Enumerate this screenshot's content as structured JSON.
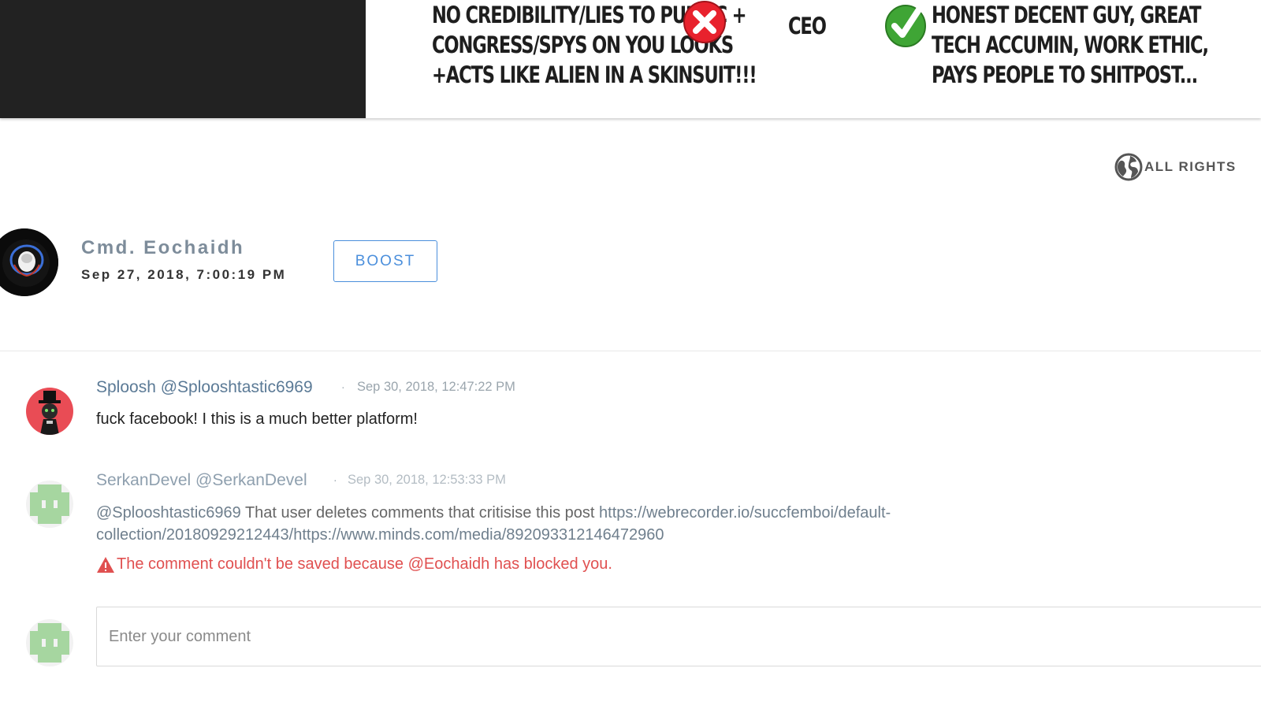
{
  "banner": {
    "left_lines": [
      "NO CREDIBILITY/LIES TO PUBLIC +",
      "CONGRESS/SPYS ON YOU LOOKS",
      "+ACTS LIKE ALIEN IN A SKINSUIT!!!"
    ],
    "center_label": "CEO",
    "right_lines": [
      "HONEST DECENT GUY, GREAT",
      "TECH ACCUMIN, WORK ETHIC,",
      "PAYS PEOPLE TO SHITPOST..."
    ],
    "x_icon": "red-x-icon",
    "check_icon": "green-check-icon"
  },
  "license": {
    "icon": "globe-icon",
    "label": "ALL RIGHTS"
  },
  "owner": {
    "name": "Cmd. Eochaidh",
    "date": "Sep 27, 2018, 7:00:19 PM",
    "boost_label": "BOOST"
  },
  "comments": [
    {
      "author": "Sploosh @Splooshtastic6969",
      "separator": "·",
      "time": "Sep 30, 2018, 12:47:22 PM",
      "body": "fuck facebook! I this is a much better platform!"
    },
    {
      "author": "SerkanDevel @SerkanDevel",
      "separator": "·",
      "time": "Sep 30, 2018, 12:53:33 PM",
      "mention": "@Splooshtastic6969",
      "text": " That user deletes comments that critisise this post ",
      "link_line1": "https://webrecorder.io/succfemboi/default-",
      "link_line2": "collection/20180929212443/https://www.minds.com/media/892093312146472960",
      "error": "The comment couldn't be saved because @Eochaidh has blocked you."
    }
  ],
  "composer": {
    "placeholder": "Enter your comment"
  },
  "colors": {
    "accent": "#4b8fdc",
    "error": "#e05050",
    "banner_dark": "#222222"
  }
}
